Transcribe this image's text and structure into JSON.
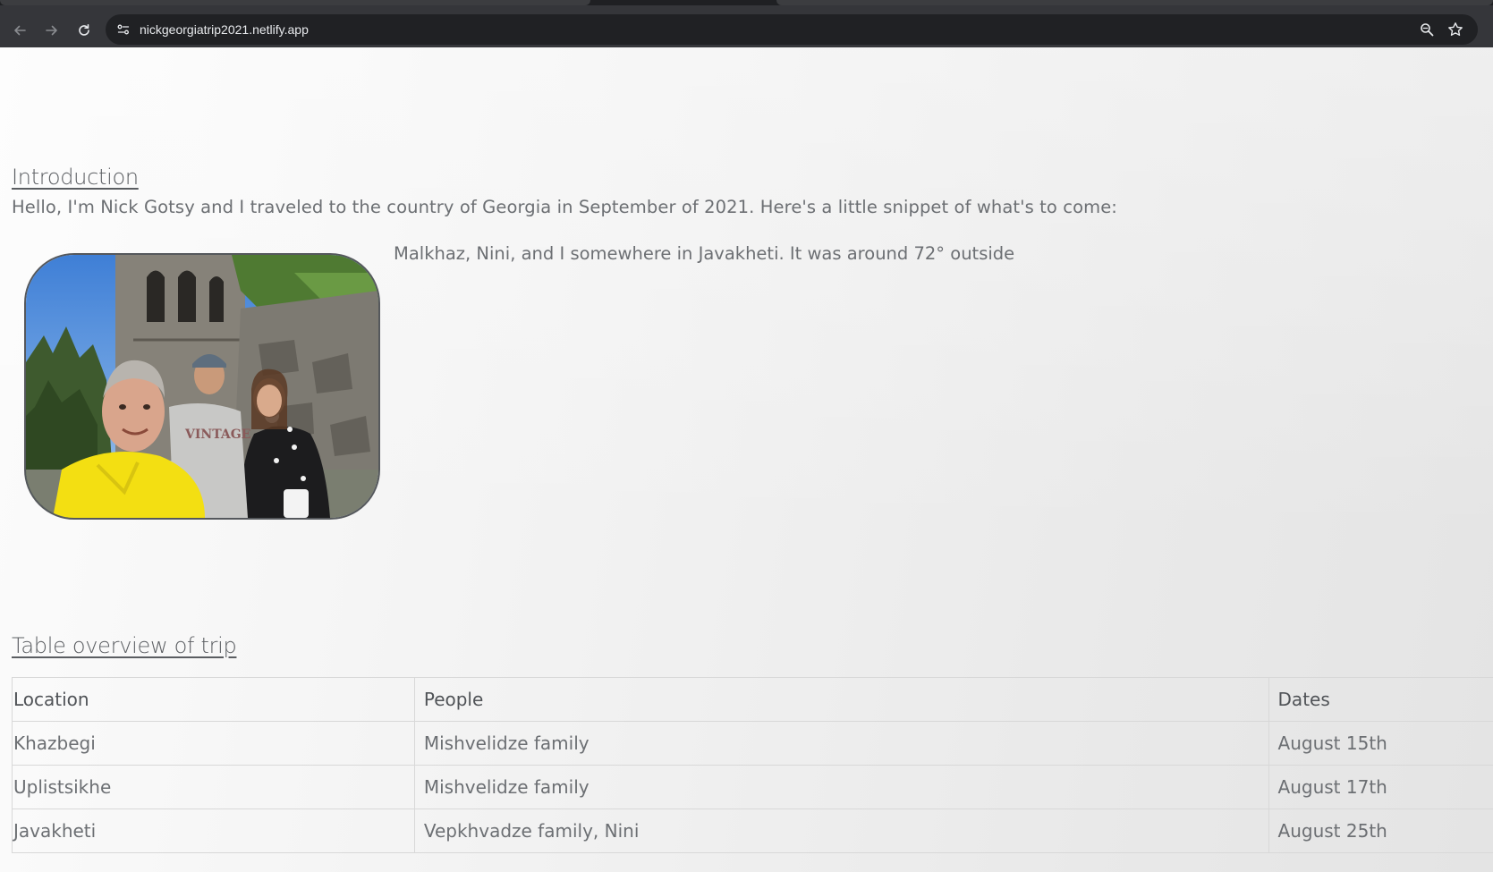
{
  "browser": {
    "url": "nickgeorgiatrip2021.netlify.app"
  },
  "intro": {
    "heading": "Introduction",
    "text": "Hello, I'm Nick Gotsy and I traveled to the country of Georgia in September of 2021. Here's a little snippet of what's to come:",
    "caption": "Malkhaz, Nini, and I somewhere in Javakheti. It was around 72° outside"
  },
  "table_section": {
    "heading": "Table overview of trip",
    "headers": [
      "Location",
      "People",
      "Dates"
    ],
    "rows": [
      [
        "Khazbegi",
        "Mishvelidze family",
        "August 15th"
      ],
      [
        "Uplistsikhe",
        "Mishvelidze family",
        "August 17th"
      ],
      [
        "Javakheti",
        "Vepkhvadze family, Nini",
        "August 25th"
      ]
    ]
  },
  "colors": {
    "chrome_bg": "#35363a",
    "omnibox_bg": "#202124",
    "text": "#6c6f73",
    "heading": "#5a5d61"
  },
  "icons": [
    "back-arrow-icon",
    "forward-arrow-icon",
    "reload-icon",
    "site-info-icon",
    "zoom-icon",
    "bookmark-star-icon"
  ]
}
